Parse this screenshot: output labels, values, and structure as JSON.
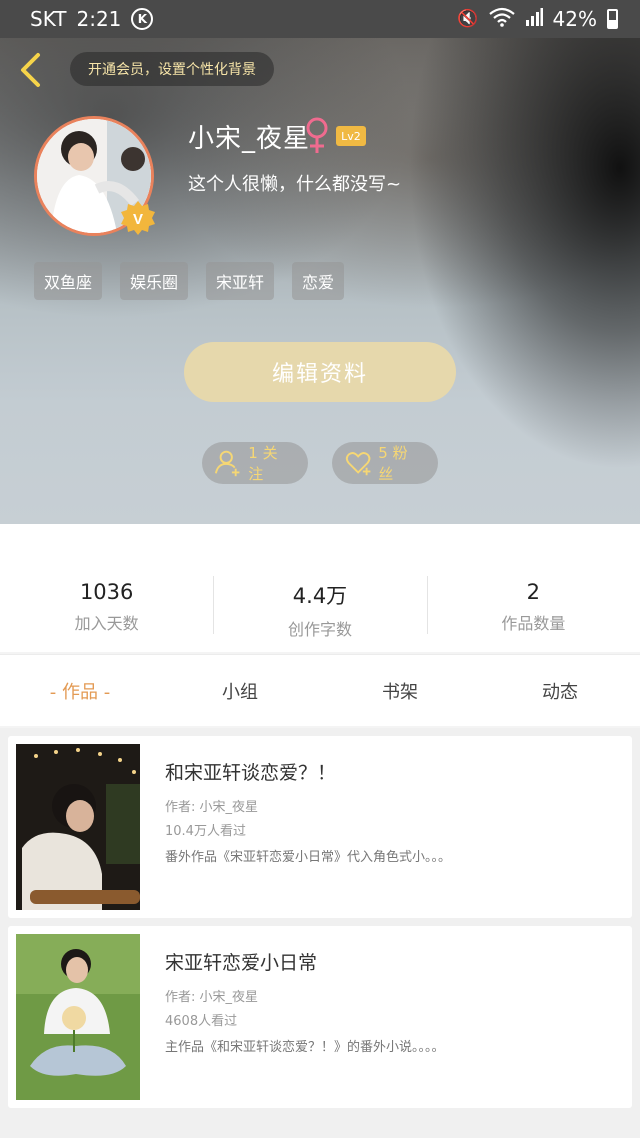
{
  "status_bar": {
    "carrier": "SKT",
    "time": "2:21",
    "carrier_badge": "K",
    "battery": "42%",
    "battery_level": 0.42
  },
  "header": {
    "vip_promo": "开通会员，设置个性化背景"
  },
  "profile": {
    "username": "小宋_夜星",
    "gender_symbol": "♀",
    "level": "Lv2",
    "verified_badge": "V",
    "bio": "这个人很懒，什么都没写~",
    "tags": [
      "双鱼座",
      "娱乐圈",
      "宋亚轩",
      "恋爱"
    ],
    "edit_button": "编辑资料",
    "following": "1 关注",
    "fans": "5 粉丝"
  },
  "stats": [
    {
      "value": "1036",
      "label": "加入天数"
    },
    {
      "value": "4.4万",
      "label": "创作字数"
    },
    {
      "value": "2",
      "label": "作品数量"
    }
  ],
  "tabs": [
    "- 作品 -",
    "小组",
    "书架",
    "动态"
  ],
  "works": [
    {
      "title": "和宋亚轩谈恋爱？！",
      "author": "作者: 小宋_夜星",
      "views": "10.4万人看过",
      "desc": "番外作品《宋亚轩恋爱小日常》代入角色式小。。。"
    },
    {
      "title": "宋亚轩恋爱小日常",
      "author": "作者: 小宋_夜星",
      "views": "4608人看过",
      "desc": "主作品《和宋亚轩谈恋爱？！》的番外小说。。。。"
    }
  ],
  "colors": {
    "accent": "#e39a53",
    "gold": "#f0b943",
    "edit_button_bg": "#e6d8ac",
    "gender": "#f06b8f",
    "avatar_ring": "#e9825c"
  }
}
